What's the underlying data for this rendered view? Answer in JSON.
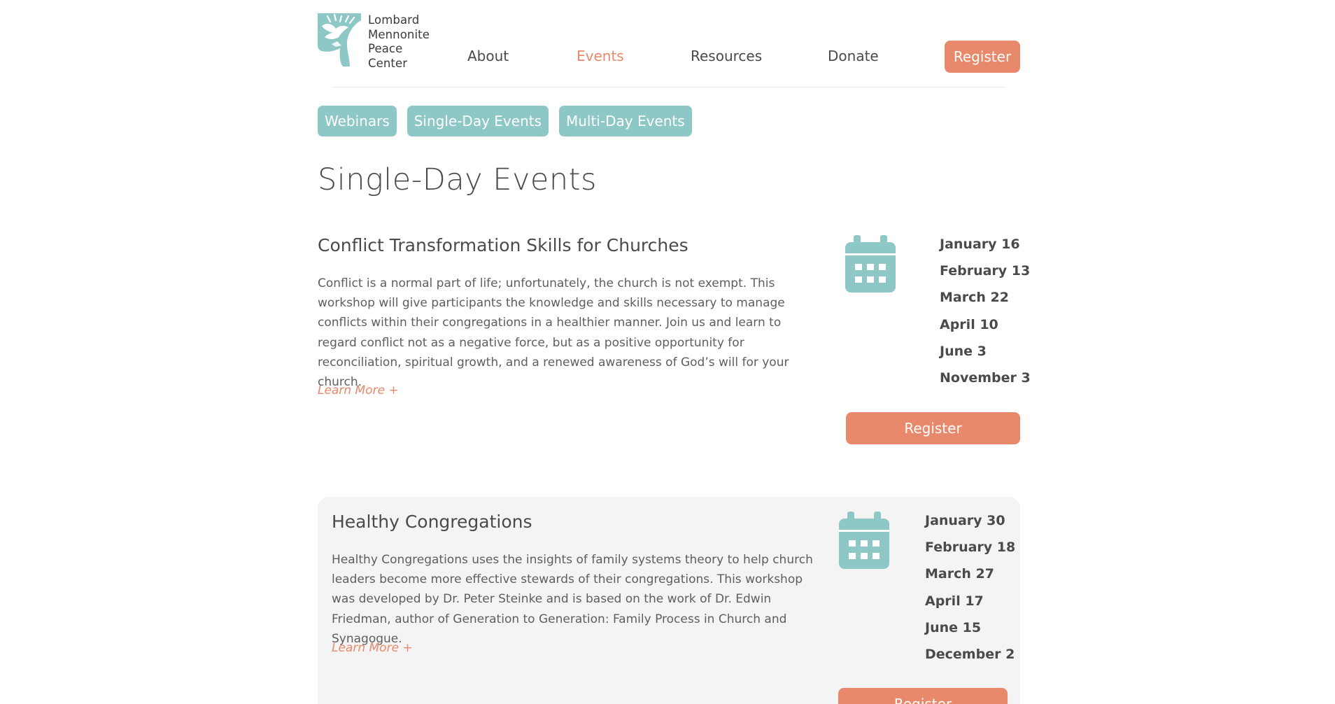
{
  "site": {
    "logo_lines": [
      "Lombard",
      "Mennonite",
      "Peace",
      "Center"
    ]
  },
  "nav": {
    "items": [
      {
        "label": "About",
        "active": false
      },
      {
        "label": "Events",
        "active": true
      },
      {
        "label": "Resources",
        "active": false
      },
      {
        "label": "Donate",
        "active": false
      }
    ],
    "register_label": "Register"
  },
  "tabs": [
    "Webinars",
    "Single-Day Events",
    "Multi-Day Events"
  ],
  "page_title": "Single-Day Events",
  "events": [
    {
      "title": "Conflict Transformation Skills for Churches",
      "description": "Conflict is a normal part of life; unfortunately, the church is not exempt. This workshop will give participants the knowledge and skills necessary to manage conflicts within their congregations in a healthier manner. Join us and learn to regard conflict not as a negative force, but as a positive opportunity for reconciliation, spiritual growth, and a renewed awareness of God’s will for your church.",
      "learn_more": "Learn More +",
      "dates": [
        "January 16",
        "February 13",
        "March 22",
        "April 10",
        "June 3",
        "November 3"
      ],
      "register_label": "Register"
    },
    {
      "title": "Healthy Congregations",
      "description": "Healthy Congregations uses the insights of family systems theory to help church leaders become more effective stewards of their congregations. This workshop was developed by Dr. Peter Steinke and is based on the work of Dr. Edwin Friedman, author of Generation to Generation: Family Process in Church and Synagogue.",
      "learn_more": "Learn More +",
      "dates": [
        "January 30",
        "February 18",
        "March 27",
        "April 17",
        "June 15",
        "December 2"
      ],
      "register_label": "Register"
    }
  ],
  "colors": {
    "accent": "#e8896c",
    "teal": "#8dc7c6",
    "card_background": "#f4f4f4",
    "text": "#4a4a4a"
  },
  "icons": {
    "logo": "dove-tree-logo-icon",
    "calendar": "calendar-icon"
  }
}
